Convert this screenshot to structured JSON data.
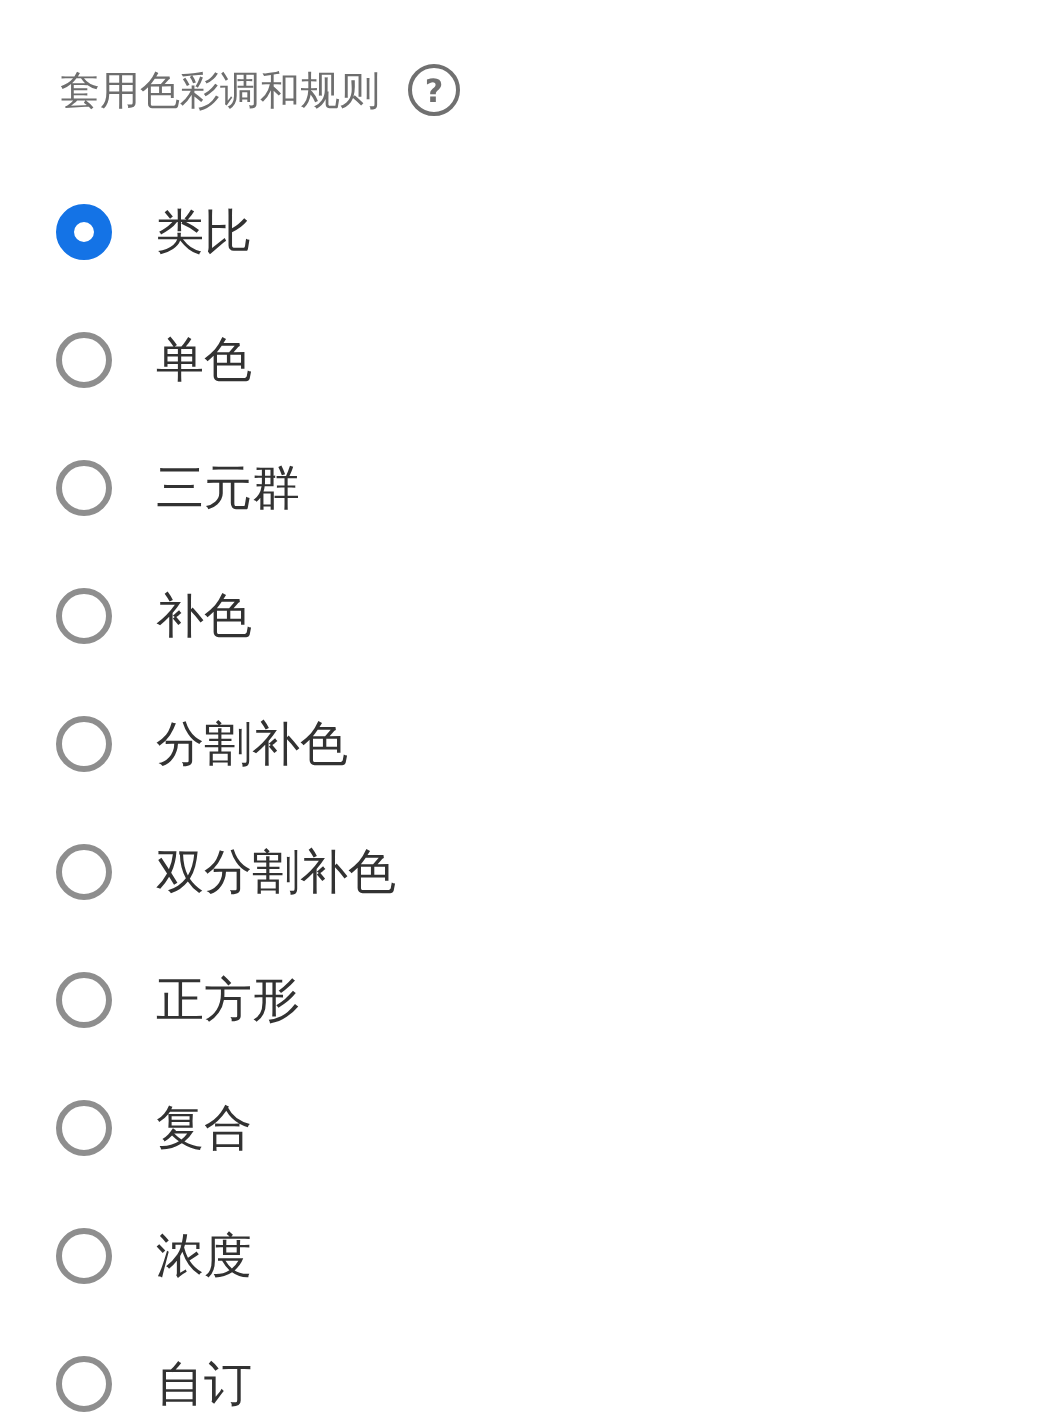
{
  "header": {
    "title": "套用色彩调和规则",
    "help": "?"
  },
  "options": [
    {
      "label": "类比",
      "selected": true
    },
    {
      "label": "单色",
      "selected": false
    },
    {
      "label": "三元群",
      "selected": false
    },
    {
      "label": "补色",
      "selected": false
    },
    {
      "label": "分割补色",
      "selected": false
    },
    {
      "label": "双分割补色",
      "selected": false
    },
    {
      "label": "正方形",
      "selected": false
    },
    {
      "label": "复合",
      "selected": false
    },
    {
      "label": "浓度",
      "selected": false
    },
    {
      "label": "自订",
      "selected": false
    }
  ]
}
